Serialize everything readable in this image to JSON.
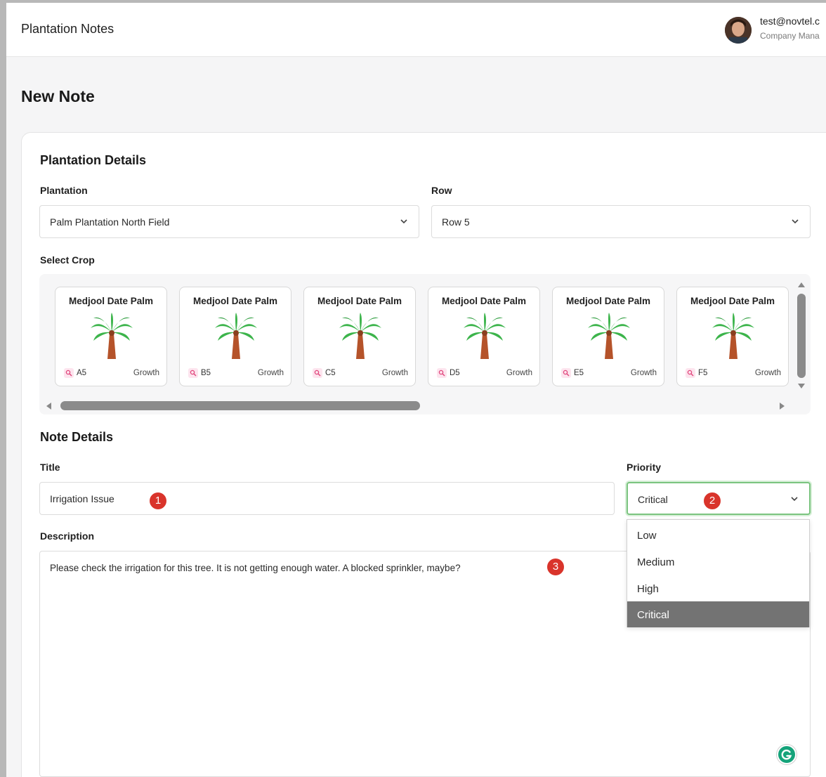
{
  "app": {
    "title": "Plantation Notes"
  },
  "user": {
    "email": "test@novtel.c",
    "role": "Company Mana"
  },
  "page": {
    "title": "New Note"
  },
  "plantation_details": {
    "section_title": "Plantation Details",
    "plantation_label": "Plantation",
    "plantation_value": "Palm Plantation North Field",
    "row_label": "Row",
    "row_value": "Row 5",
    "select_crop_label": "Select Crop",
    "crops": [
      {
        "name": "Medjool Date Palm",
        "code": "A5",
        "status": "Growth"
      },
      {
        "name": "Medjool Date Palm",
        "code": "B5",
        "status": "Growth"
      },
      {
        "name": "Medjool Date Palm",
        "code": "C5",
        "status": "Growth"
      },
      {
        "name": "Medjool Date Palm",
        "code": "D5",
        "status": "Growth"
      },
      {
        "name": "Medjool Date Palm",
        "code": "E5",
        "status": "Growth"
      },
      {
        "name": "Medjool Date Palm",
        "code": "F5",
        "status": "Growth"
      }
    ]
  },
  "note_details": {
    "section_title": "Note Details",
    "title_label": "Title",
    "title_value": "Irrigation Issue",
    "priority_label": "Priority",
    "priority_value": "Critical",
    "priority_options": [
      "Low",
      "Medium",
      "High",
      "Critical"
    ],
    "description_label": "Description",
    "description_value": "Please check the irrigation for this tree. It is not getting enough water. A blocked sprinkler, maybe?"
  },
  "annotations": [
    "1",
    "2",
    "3"
  ],
  "icons": {
    "chevron": "chevron-down-icon",
    "crop": "palm-tree-icon",
    "tag": "search-icon",
    "assistant": "grammarly-icon"
  },
  "colors": {
    "badge": "#d9342b",
    "priority_focus": "#7bc47f",
    "selected_option": "#737373",
    "palm_leaf": "#3cb44b",
    "palm_trunk": "#b5532a"
  }
}
